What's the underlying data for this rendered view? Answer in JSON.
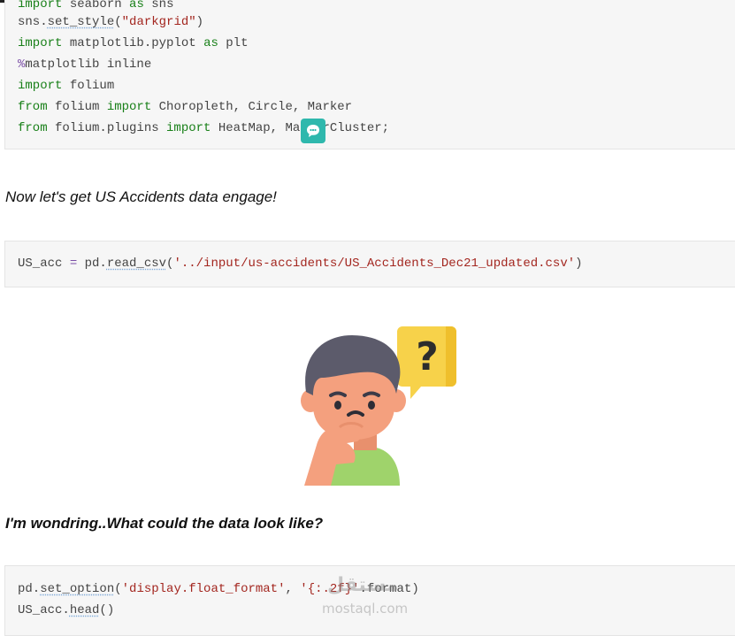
{
  "cells": {
    "imports": {
      "lines": [
        {
          "parts": [
            {
              "t": "import",
              "c": "kw"
            },
            {
              "t": " seaborn ",
              "c": ""
            },
            {
              "t": "as",
              "c": "kw"
            },
            {
              "t": " sns",
              "c": ""
            }
          ]
        },
        {
          "parts": [
            {
              "t": "sns.",
              "c": ""
            },
            {
              "t": "set_style",
              "c": "fn"
            },
            {
              "t": "(",
              "c": ""
            },
            {
              "t": "\"darkgrid\"",
              "c": "str"
            },
            {
              "t": ")",
              "c": ""
            }
          ]
        },
        {
          "parts": [
            {
              "t": "import",
              "c": "kw"
            },
            {
              "t": " matplotlib.pyplot ",
              "c": ""
            },
            {
              "t": "as",
              "c": "kw"
            },
            {
              "t": " plt",
              "c": ""
            }
          ]
        },
        {
          "parts": [
            {
              "t": "%",
              "c": "op"
            },
            {
              "t": "matplotlib",
              "c": ""
            },
            {
              "t": " inline",
              "c": ""
            }
          ]
        },
        {
          "parts": [
            {
              "t": "import",
              "c": "kw"
            },
            {
              "t": " folium",
              "c": ""
            }
          ]
        },
        {
          "parts": [
            {
              "t": "from",
              "c": "kw"
            },
            {
              "t": " folium ",
              "c": ""
            },
            {
              "t": "import",
              "c": "kw"
            },
            {
              "t": " Choropleth, Circle, Marker",
              "c": ""
            }
          ]
        },
        {
          "parts": [
            {
              "t": "from",
              "c": "kw"
            },
            {
              "t": " folium.plugins ",
              "c": ""
            },
            {
              "t": "import",
              "c": "kw"
            },
            {
              "t": " HeatMap, MarkerCluster;",
              "c": ""
            }
          ]
        }
      ]
    },
    "read_csv": {
      "lines": [
        {
          "parts": [
            {
              "t": "US_acc ",
              "c": ""
            },
            {
              "t": "=",
              "c": "op"
            },
            {
              "t": " pd.",
              "c": ""
            },
            {
              "t": "read_csv",
              "c": "fn"
            },
            {
              "t": "(",
              "c": ""
            },
            {
              "t": "'../input/us-accidents/US_Accidents_Dec21_updated.csv'",
              "c": "str"
            },
            {
              "t": ")",
              "c": ""
            }
          ]
        }
      ]
    },
    "head": {
      "lines": [
        {
          "parts": [
            {
              "t": "pd.",
              "c": ""
            },
            {
              "t": "set_option",
              "c": "fn"
            },
            {
              "t": "(",
              "c": ""
            },
            {
              "t": "'display.float_format'",
              "c": "str"
            },
            {
              "t": ", ",
              "c": ""
            },
            {
              "t": "'{:.2f}'",
              "c": "str"
            },
            {
              "t": ".format)",
              "c": ""
            }
          ]
        },
        {
          "parts": [
            {
              "t": "US_acc.",
              "c": ""
            },
            {
              "t": "head",
              "c": "fn"
            },
            {
              "t": "()",
              "c": ""
            }
          ]
        }
      ]
    }
  },
  "markdown": {
    "intro": "Now let's get US Accidents data engage!",
    "wonder": "I'm wondring..What could the data look like?"
  },
  "illustration": {
    "icon": "thinking-boy-question-icon",
    "question_mark": "?",
    "colors": {
      "hair": "#5c5b6b",
      "skin": "#f4a07e",
      "shirt": "#9fd36b",
      "bubble": "#f7d24a"
    }
  },
  "watermark": {
    "arabic": "مستقل",
    "latin": "mostaql.com"
  },
  "accent_color": "#2fb8ad"
}
